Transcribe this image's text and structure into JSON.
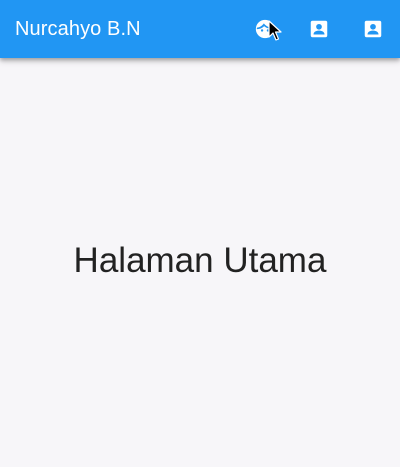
{
  "app_bar": {
    "title": "Nurcahyo B.N",
    "background_color": "#2196f3",
    "actions": [
      {
        "icon": "face-icon",
        "label": ""
      },
      {
        "icon": "account-box-icon",
        "label": ""
      },
      {
        "icon": "account-box-icon",
        "label": ""
      }
    ]
  },
  "main": {
    "text": "Halaman Utama"
  }
}
